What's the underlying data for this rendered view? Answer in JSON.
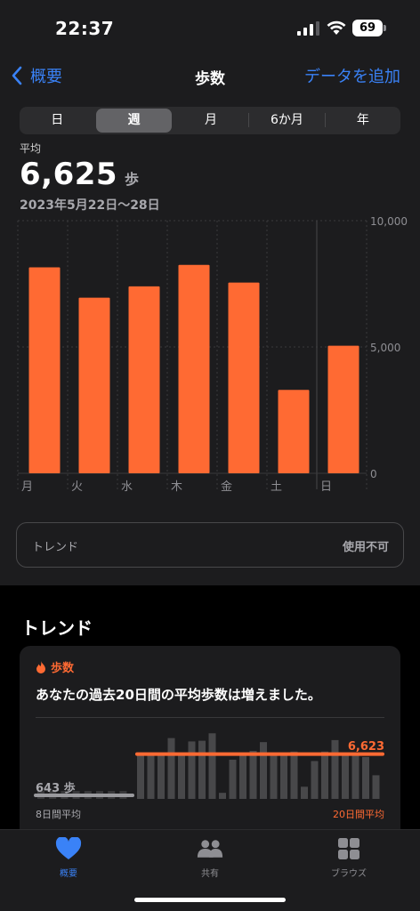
{
  "status": {
    "time": "22:37",
    "battery": "69"
  },
  "nav": {
    "back_label": "概要",
    "title": "歩数",
    "add_label": "データを追加"
  },
  "segments": [
    "日",
    "週",
    "月",
    "6か月",
    "年"
  ],
  "selected_segment": "週",
  "summary": {
    "avg_label": "平均",
    "avg_value": "6,625",
    "unit": "歩",
    "date_range": "2023年5月22日〜28日"
  },
  "chart_data": {
    "type": "bar",
    "categories": [
      "月",
      "火",
      "水",
      "木",
      "金",
      "土",
      "日"
    ],
    "values": [
      8150,
      6950,
      7400,
      8250,
      7550,
      3300,
      5050
    ],
    "ylim": [
      0,
      10000
    ],
    "y_ticks": [
      "10,000",
      "5,000",
      "0"
    ],
    "y_tick_values": [
      10000,
      5000,
      0
    ],
    "color": "#ff6a33"
  },
  "trend_row": {
    "label": "トレンド",
    "value": "使用不可"
  },
  "trends": {
    "title": "トレンド",
    "card": {
      "category": "歩数",
      "message": "あなたの過去20日間の平均歩数は増えました。",
      "prev_value": "643 歩",
      "current_value": "6,623",
      "prev_label": "8日間平均",
      "current_label": "20日間平均",
      "prev_bars": [
        643,
        643,
        643,
        643,
        643,
        643,
        643,
        643
      ],
      "recent_bars": [
        6623,
        6623,
        6623,
        9000,
        6623,
        8500,
        8600,
        9700,
        900,
        5800,
        6600,
        7100,
        8400,
        6700,
        6800,
        7000,
        1800,
        5600,
        7000,
        8700,
        6600,
        6600,
        6200,
        3500
      ]
    }
  },
  "tabs": [
    {
      "label": "概要",
      "icon": "heart-icon",
      "active": true
    },
    {
      "label": "共有",
      "icon": "people-icon",
      "active": false
    },
    {
      "label": "ブラウズ",
      "icon": "grid-icon",
      "active": false
    }
  ],
  "colors": {
    "accent": "#3a82f7",
    "steps": "#ff6a33"
  }
}
